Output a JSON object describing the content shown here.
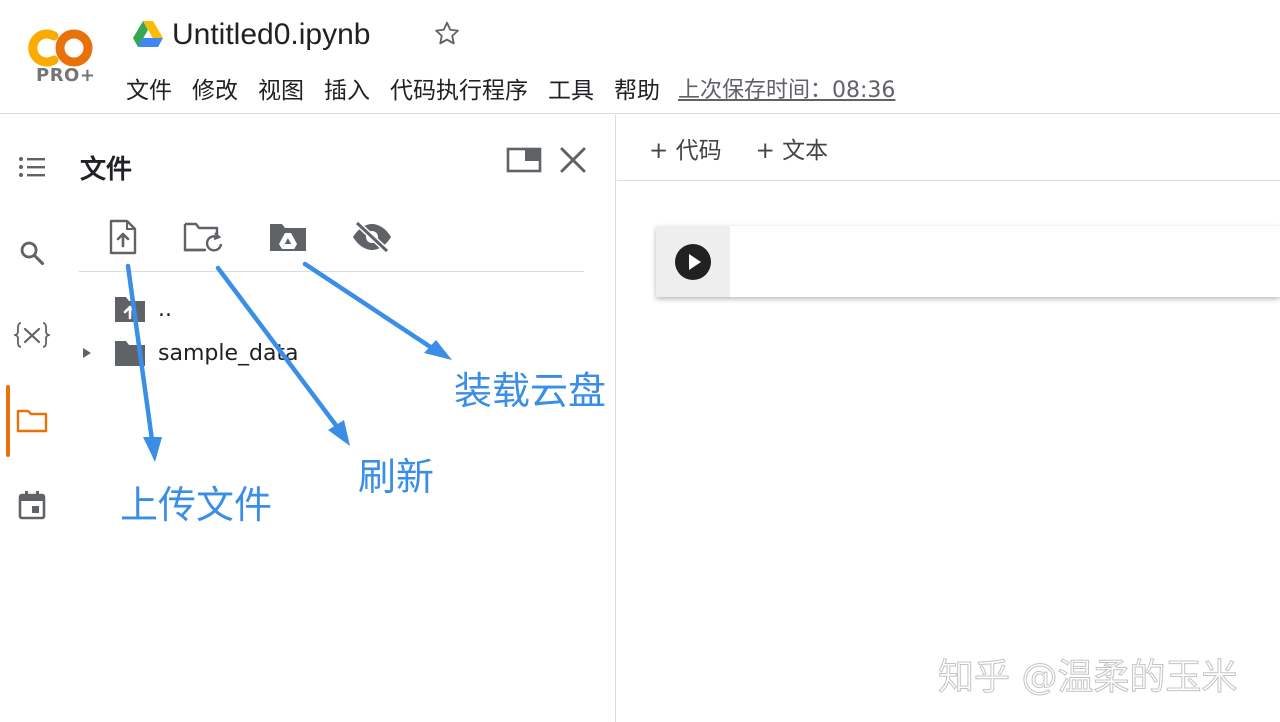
{
  "header": {
    "logo_sub": "PRO+",
    "notebook_title": "Untitled0.ipynb",
    "menu": [
      "文件",
      "修改",
      "视图",
      "插入",
      "代码执行程序",
      "工具",
      "帮助"
    ],
    "last_saved": "上次保存时间：08:36"
  },
  "panel": {
    "title": "文件",
    "tree": [
      {
        "label": ".."
      },
      {
        "label": "sample_data"
      }
    ]
  },
  "notebook": {
    "toolbar": {
      "add_code": "+ 代码",
      "add_text": "+ 文本"
    }
  },
  "annotations": {
    "upload": "上传文件",
    "refresh": "刷新",
    "mount_drive": "装载云盘"
  },
  "watermark": "知乎 @温柔的玉米",
  "colors": {
    "accent_orange": "#e8710a",
    "annotation_blue": "#3a8ee6",
    "logo_orange": "#f9ab00",
    "logo_dark_orange": "#e8710a"
  },
  "icons": {
    "rail": [
      "toc-icon",
      "search-icon",
      "variables-icon",
      "folder-icon",
      "calendar-icon"
    ],
    "toolbar": [
      "upload-file-icon",
      "refresh-folder-icon",
      "mount-drive-icon",
      "hide-files-icon"
    ]
  }
}
